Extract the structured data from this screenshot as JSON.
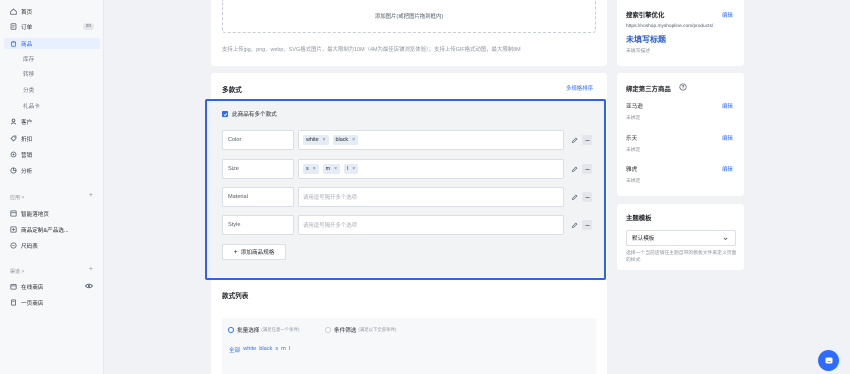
{
  "sidebar": {
    "items": [
      {
        "label": "首页",
        "icon": "home-icon"
      },
      {
        "label": "订单",
        "icon": "order-icon",
        "badge": "20"
      },
      {
        "label": "商品",
        "icon": "product-icon"
      },
      {
        "label": "库存"
      },
      {
        "label": "转移"
      },
      {
        "label": "分类"
      },
      {
        "label": "礼品卡"
      },
      {
        "label": "客户",
        "icon": "customer-icon"
      },
      {
        "label": "折扣",
        "icon": "discount-icon"
      },
      {
        "label": "营销",
        "icon": "marketing-icon"
      },
      {
        "label": "分析",
        "icon": "analytics-icon"
      }
    ],
    "apps_title": "应用 >",
    "apps": [
      {
        "label": "智能落地页"
      },
      {
        "label": "商品定制&产品选..."
      },
      {
        "label": "尺码表"
      }
    ],
    "channels_title": "渠道 >",
    "channels": [
      {
        "label": "在线商店"
      },
      {
        "label": "一页商店"
      }
    ]
  },
  "media": {
    "upload_label": "添加图片(或把图片拖到框内)",
    "hint": "支持上传jpg、png、webp、SVG格式图片，最大限制为10M（4M为最佳店铺浏览体验）；支持上传GIF格式动图，最大限制8M"
  },
  "variants": {
    "title": "多款式",
    "sort_link": "多规格排序",
    "checkbox_label": "此商品有多个款式",
    "options": [
      {
        "name": "Color",
        "values": [
          "white",
          "black"
        ],
        "placeholder": ""
      },
      {
        "name": "Size",
        "values": [
          "s",
          "m",
          "l"
        ],
        "placeholder": ""
      },
      {
        "name": "Material",
        "values": [],
        "placeholder": "请用逗号隔开多个选项"
      },
      {
        "name": "Style",
        "values": [],
        "placeholder": "请用逗号隔开多个选项"
      }
    ],
    "add_button": "添加商品规格"
  },
  "variant_list": {
    "title": "款式列表",
    "radio_batch": "批量选择",
    "radio_batch_note": "(满足任意一个条件)",
    "radio_filter": "条件筛选",
    "radio_filter_note": "(满足以下全部条件)",
    "quick": [
      "全部",
      "white",
      "black",
      "s",
      "m",
      "l"
    ]
  },
  "seo": {
    "title": "搜索引擎优化",
    "edit": "编辑",
    "url": "https://noshop.myshopline.com/products/",
    "headline": "未填写标题",
    "desc": "未填写描述"
  },
  "third_party": {
    "title": "绑定第三方商品",
    "items": [
      {
        "name": "亚马逊",
        "status": "未绑定",
        "edit": "编辑"
      },
      {
        "name": "乐天",
        "status": "未绑定",
        "edit": "编辑"
      },
      {
        "name": "雅虎",
        "status": "未绑定",
        "edit": "编辑"
      }
    ]
  },
  "theme": {
    "title": "主题模板",
    "selected": "默认模板",
    "desc": "选择一个当前店铺在主题自带的模板文件来定义页面的样式"
  },
  "colors": {
    "accent": "#2f6bff",
    "highlight": "#2f64e6"
  }
}
